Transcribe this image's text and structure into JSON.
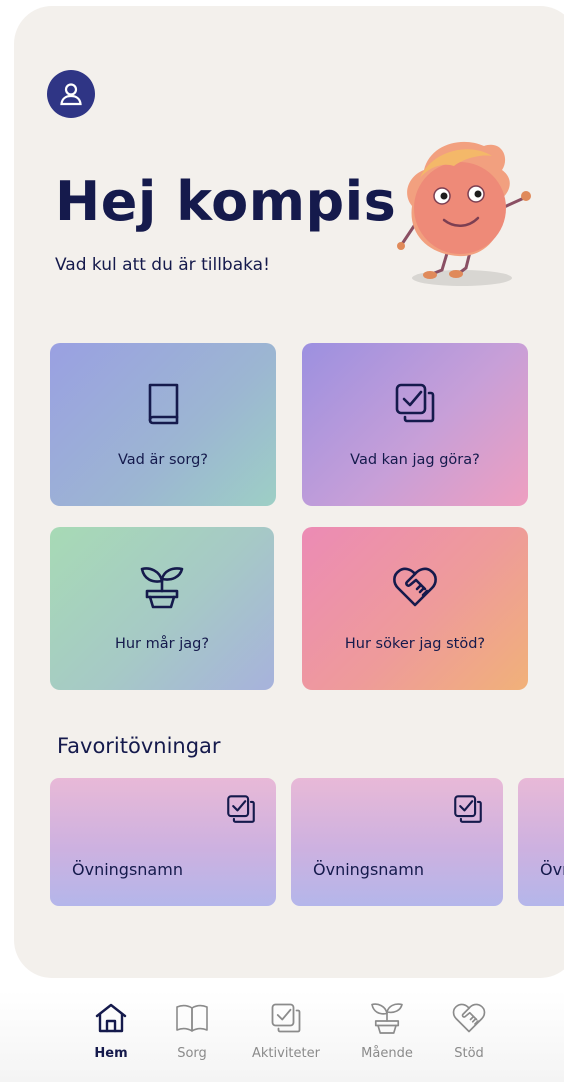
{
  "header": {
    "greeting": "Hej kompis",
    "subtitle": "Vad kul att du är tillbaka!"
  },
  "tiles": [
    {
      "label": "Vad är sorg?",
      "icon": "book-icon"
    },
    {
      "label": "Vad kan jag göra?",
      "icon": "checkbox-icon"
    },
    {
      "label": "Hur mår jag?",
      "icon": "plant-icon"
    },
    {
      "label": "Hur söker jag stöd?",
      "icon": "heart-handshake-icon"
    }
  ],
  "favorites": {
    "title": "Favoritövningar",
    "items": [
      {
        "label": "Övningsnamn"
      },
      {
        "label": "Övningsnamn"
      },
      {
        "label": "Övningsnamn"
      }
    ]
  },
  "tabbar": {
    "tabs": [
      {
        "label": "Hem",
        "icon": "home-icon",
        "active": true
      },
      {
        "label": "Sorg",
        "icon": "book-open-icon",
        "active": false
      },
      {
        "label": "Aktiviteter",
        "icon": "checkbox-icon",
        "active": false
      },
      {
        "label": "Mående",
        "icon": "plant-icon",
        "active": false
      },
      {
        "label": "Stöd",
        "icon": "heart-handshake-icon",
        "active": false
      }
    ]
  },
  "colors": {
    "ink": "#151a4c",
    "avatar_bg": "#2f3585",
    "card_bg": "#f3f0ec",
    "tab_inactive": "#8b8b8b"
  }
}
